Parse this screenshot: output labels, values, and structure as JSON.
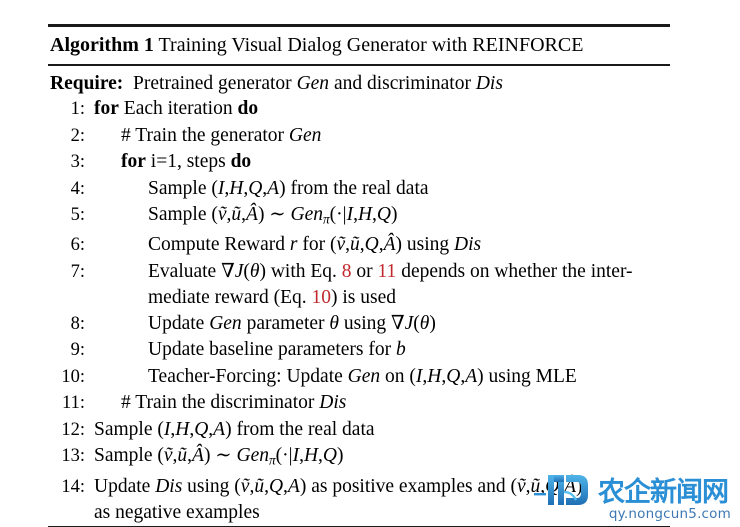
{
  "document": {
    "kind": "algorithm-float",
    "title_label": "Algorithm 1",
    "title_text": "Training Visual Dialog Generator with REINFORCE",
    "require_label": "Require:",
    "require_text_a": "Pretrained generator ",
    "require_math_gen": "Gen",
    "require_text_b": " and discriminator ",
    "require_math_dis": "Dis"
  },
  "lines": [
    {
      "num": "1:",
      "indent": 1,
      "parts": [
        {
          "t": "for",
          "style": "bold"
        },
        {
          "t": " Each iteration ",
          "style": "plain"
        },
        {
          "t": "do",
          "style": "bold"
        }
      ]
    },
    {
      "num": "2:",
      "indent": 2,
      "parts": [
        {
          "t": "# Train the generator ",
          "style": "plain"
        },
        {
          "t": "Gen",
          "style": "math"
        }
      ]
    },
    {
      "num": "3:",
      "indent": 2,
      "parts": [
        {
          "t": "for",
          "style": "bold"
        },
        {
          "t": " i=1, steps ",
          "style": "plain"
        },
        {
          "t": "do",
          "style": "bold"
        }
      ]
    },
    {
      "num": "4:",
      "indent": 3,
      "parts": [
        {
          "t": "Sample (",
          "style": "plain"
        },
        {
          "t": "I",
          "style": "math"
        },
        {
          "t": ",",
          "style": "plain"
        },
        {
          "t": "H",
          "style": "math"
        },
        {
          "t": ",",
          "style": "plain"
        },
        {
          "t": "Q",
          "style": "math"
        },
        {
          "t": ",",
          "style": "plain"
        },
        {
          "t": "A",
          "style": "math"
        },
        {
          "t": ") from the real data",
          "style": "plain"
        }
      ]
    },
    {
      "num": "5:",
      "indent": 3,
      "parts": [
        {
          "t": "Sample (",
          "style": "plain"
        },
        {
          "t": "ṽ",
          "style": "math"
        },
        {
          "t": ",",
          "style": "plain"
        },
        {
          "t": "ũ",
          "style": "math"
        },
        {
          "t": ",",
          "style": "plain"
        },
        {
          "t": "Â",
          "style": "math"
        },
        {
          "t": ") ∼ ",
          "style": "plain"
        },
        {
          "t": "Gen",
          "style": "math"
        },
        {
          "t": "π",
          "style": "sub"
        },
        {
          "t": "(·|",
          "style": "plain"
        },
        {
          "t": "I",
          "style": "math"
        },
        {
          "t": ",",
          "style": "plain"
        },
        {
          "t": "H",
          "style": "math"
        },
        {
          "t": ",",
          "style": "plain"
        },
        {
          "t": "Q",
          "style": "math"
        },
        {
          "t": ")",
          "style": "plain"
        }
      ]
    },
    {
      "num": "6:",
      "indent": 3,
      "parts": [
        {
          "t": "Compute Reward ",
          "style": "plain"
        },
        {
          "t": "r",
          "style": "math"
        },
        {
          "t": " for (",
          "style": "plain"
        },
        {
          "t": "ṽ",
          "style": "math"
        },
        {
          "t": ",",
          "style": "plain"
        },
        {
          "t": "ũ",
          "style": "math"
        },
        {
          "t": ",",
          "style": "plain"
        },
        {
          "t": "Q",
          "style": "math"
        },
        {
          "t": ",",
          "style": "plain"
        },
        {
          "t": "Â",
          "style": "math"
        },
        {
          "t": ") using ",
          "style": "plain"
        },
        {
          "t": "Dis",
          "style": "math"
        }
      ]
    },
    {
      "num": "7:",
      "indent": 3,
      "parts": [
        {
          "t": "Evaluate ∇",
          "style": "plain"
        },
        {
          "t": "J",
          "style": "math"
        },
        {
          "t": "(",
          "style": "plain"
        },
        {
          "t": "θ",
          "style": "math"
        },
        {
          "t": ") with Eq. ",
          "style": "plain"
        },
        {
          "t": "8",
          "style": "eqref"
        },
        {
          "t": " or ",
          "style": "plain"
        },
        {
          "t": "11",
          "style": "eqref"
        },
        {
          "t": " depends on whether the inter-",
          "style": "plain"
        }
      ]
    },
    {
      "num": "",
      "indent": 3,
      "continuation": true,
      "parts": [
        {
          "t": "mediate reward (Eq. ",
          "style": "plain"
        },
        {
          "t": "10",
          "style": "eqref"
        },
        {
          "t": ") is used",
          "style": "plain"
        }
      ]
    },
    {
      "num": "8:",
      "indent": 3,
      "parts": [
        {
          "t": "Update ",
          "style": "plain"
        },
        {
          "t": "Gen",
          "style": "math"
        },
        {
          "t": " parameter ",
          "style": "plain"
        },
        {
          "t": "θ",
          "style": "math"
        },
        {
          "t": " using ∇",
          "style": "plain"
        },
        {
          "t": "J",
          "style": "math"
        },
        {
          "t": "(",
          "style": "plain"
        },
        {
          "t": "θ",
          "style": "math"
        },
        {
          "t": ")",
          "style": "plain"
        }
      ]
    },
    {
      "num": "9:",
      "indent": 3,
      "parts": [
        {
          "t": "Update baseline parameters for ",
          "style": "plain"
        },
        {
          "t": "b",
          "style": "math"
        }
      ]
    },
    {
      "num": "10:",
      "indent": 3,
      "parts": [
        {
          "t": "Teacher-Forcing: Update ",
          "style": "plain"
        },
        {
          "t": "Gen",
          "style": "math"
        },
        {
          "t": " on (",
          "style": "plain"
        },
        {
          "t": "I",
          "style": "math"
        },
        {
          "t": ",",
          "style": "plain"
        },
        {
          "t": "H",
          "style": "math"
        },
        {
          "t": ",",
          "style": "plain"
        },
        {
          "t": "Q",
          "style": "math"
        },
        {
          "t": ",",
          "style": "plain"
        },
        {
          "t": "A",
          "style": "math"
        },
        {
          "t": ") using MLE",
          "style": "plain"
        }
      ]
    },
    {
      "num": "11:",
      "indent": 2,
      "parts": [
        {
          "t": "# Train the discriminator ",
          "style": "plain"
        },
        {
          "t": "Dis",
          "style": "math"
        }
      ]
    },
    {
      "num": "12:",
      "indent": 1,
      "parts": [
        {
          "t": "Sample (",
          "style": "plain"
        },
        {
          "t": "I",
          "style": "math"
        },
        {
          "t": ",",
          "style": "plain"
        },
        {
          "t": "H",
          "style": "math"
        },
        {
          "t": ",",
          "style": "plain"
        },
        {
          "t": "Q",
          "style": "math"
        },
        {
          "t": ",",
          "style": "plain"
        },
        {
          "t": "A",
          "style": "math"
        },
        {
          "t": ") from the real data",
          "style": "plain"
        }
      ]
    },
    {
      "num": "13:",
      "indent": 1,
      "parts": [
        {
          "t": "Sample (",
          "style": "plain"
        },
        {
          "t": "ṽ",
          "style": "math"
        },
        {
          "t": ",",
          "style": "plain"
        },
        {
          "t": "ũ",
          "style": "math"
        },
        {
          "t": ",",
          "style": "plain"
        },
        {
          "t": "Â",
          "style": "math"
        },
        {
          "t": ") ∼ ",
          "style": "plain"
        },
        {
          "t": "Gen",
          "style": "math"
        },
        {
          "t": "π",
          "style": "sub"
        },
        {
          "t": "(·|",
          "style": "plain"
        },
        {
          "t": "I",
          "style": "math"
        },
        {
          "t": ",",
          "style": "plain"
        },
        {
          "t": "H",
          "style": "math"
        },
        {
          "t": ",",
          "style": "plain"
        },
        {
          "t": "Q",
          "style": "math"
        },
        {
          "t": ")",
          "style": "plain"
        }
      ]
    },
    {
      "num": "14:",
      "indent": 1,
      "parts": [
        {
          "t": "Update ",
          "style": "plain"
        },
        {
          "t": "Dis",
          "style": "math"
        },
        {
          "t": " using (",
          "style": "plain"
        },
        {
          "t": "ṽ",
          "style": "math"
        },
        {
          "t": ",",
          "style": "plain"
        },
        {
          "t": "ũ",
          "style": "math"
        },
        {
          "t": ",",
          "style": "plain"
        },
        {
          "t": "Q",
          "style": "math"
        },
        {
          "t": ",",
          "style": "plain"
        },
        {
          "t": "A",
          "style": "math"
        },
        {
          "t": ") as positive examples and (",
          "style": "plain"
        },
        {
          "t": "ṽ",
          "style": "math"
        },
        {
          "t": ",",
          "style": "plain"
        },
        {
          "t": "ũ",
          "style": "math"
        },
        {
          "t": ",",
          "style": "plain"
        },
        {
          "t": "Q",
          "style": "math"
        },
        {
          "t": ",",
          "style": "plain"
        },
        {
          "t": "Â",
          "style": "math"
        },
        {
          "t": ")",
          "style": "plain"
        }
      ]
    },
    {
      "num": "",
      "indent": 1,
      "continuation": true,
      "parts": [
        {
          "t": "as negative examples",
          "style": "plain"
        }
      ]
    }
  ],
  "watermark": {
    "logo_mark": "nd-monogram-logo",
    "site_name": "农企新闻网",
    "url": "qy.nongcun5.com",
    "brand_color": "#2b8fd6",
    "url_color": "#3d78b5"
  },
  "colors": {
    "rule": "#1a1a1a",
    "text": "#000000",
    "eqref_red": "#c0282d",
    "background": "#ffffff"
  }
}
